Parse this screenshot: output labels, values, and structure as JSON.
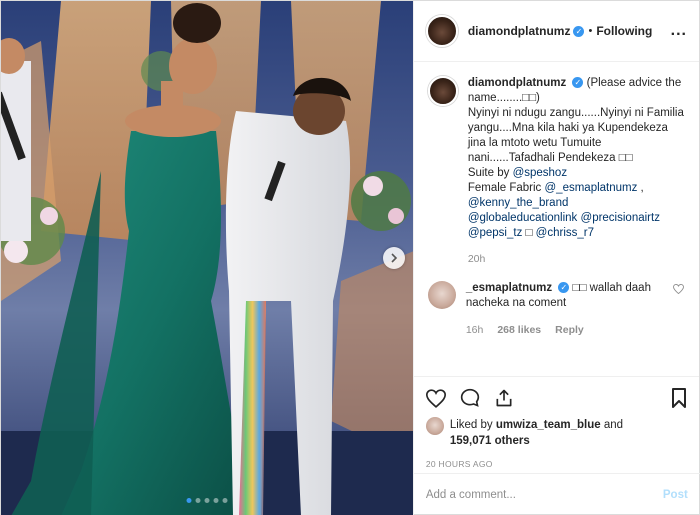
{
  "post": {
    "username": "diamondplatnumz",
    "separator": "•",
    "follow_state": "Following",
    "more_label": "...",
    "verified_mark": "✓"
  },
  "caption": {
    "username": "diamondplatnumz",
    "line1": "(Please advice the name........□□)",
    "line2": "Nyinyi ni ndugu zangu......Nyinyi ni Familia yangu....Mna kila haki ya Kupendekeza jina la mtoto wetu Tumuite nani......Tafadhali Pendekeza □□",
    "suite_prefix": "Suite by ",
    "suite_mention": "@speshoz",
    "fabric_prefix": "Female Fabric ",
    "fabric_mention": "@_esmaplatnumz",
    "fabric_comma": " ,",
    "mention_kenny": "@kenny_the_brand",
    "mention_global": "@globaleducationlink",
    "mention_precision": "@precisionairtz",
    "mention_pepsi": "@pepsi_tz",
    "pepsi_glyph": " □ ",
    "mention_chriss": "@chriss_r7",
    "time": "20h"
  },
  "reply_comment": {
    "username": "_esmaplatnumz",
    "text": "□□ wallah daah nacheka na coment",
    "time": "16h",
    "likes": "268 likes",
    "reply_label": "Reply"
  },
  "likes": {
    "prefix": "Liked by ",
    "user": "umwiza_team_blue",
    "and": " and",
    "count": "159,071 others"
  },
  "timestamp": "20 HOURS AGO",
  "add_comment": {
    "placeholder": "Add a comment...",
    "post_label": "Post"
  },
  "carousel": {
    "total": 5,
    "active_index": 0
  },
  "colors": {
    "accent": "#3897f0",
    "link": "#003569",
    "muted": "#8e8e8e",
    "post_disabled": "#b2dffc"
  }
}
